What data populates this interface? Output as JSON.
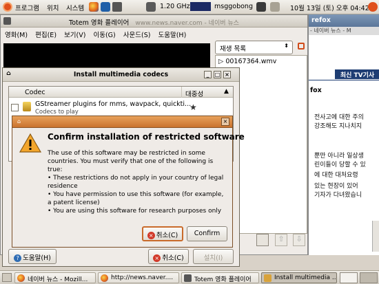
{
  "top_panel": {
    "menus": [
      "프로그램",
      "위치",
      "시스템"
    ],
    "cpu": "1.20 GHz",
    "user": "msggobong",
    "clock": "10월 13일 (토) 오후 04:42"
  },
  "browser_bg": {
    "title_fragment": "refox",
    "url_fragment": "- 네이버 뉴스 - M",
    "tab_label": "최신 TV기사",
    "lines": [
      "전사고에 대한 주의",
      "강조해도 지나치지",
      "뿐만 아니라 일상생",
      "린이들이 당할 수 있",
      "에 대한 대처요령",
      "있는 현장이 있어",
      "기자가 다녀왔습니"
    ]
  },
  "totem": {
    "title": "Totem 영화 플레이어",
    "menu": [
      "영화(M)",
      "편집(E)",
      "보기(V)",
      "이동(G)",
      "사운드(S)",
      "도움말(H)"
    ],
    "playlist_combo": "재생 목록",
    "playlist_item": "00167364.wmv"
  },
  "codecs_dialog": {
    "title": "Install multimedia codecs",
    "col_codec": "Codec",
    "col_popularity": "대중성",
    "row_title": "GStreamer plugins for mms, wavpack, quickti...",
    "row_subtitle": "Codecs to play",
    "help_button": "도움말(H)",
    "cancel_button": "취소(C)",
    "install_button": "설치(I)"
  },
  "confirm_dialog": {
    "heading": "Confirm installation of restricted software",
    "body": "The use of this software may be restricted in some countries. You must verify that one of the following is true:",
    "bullets": [
      "• These restrictions do not apply in your country of legal residence",
      "• You have permission to use this software (for  example, a patent license)",
      "• You are using this software for research purposes only"
    ],
    "cancel_button": "취소(C)",
    "confirm_button": "Confirm"
  },
  "taskbar": {
    "tasks": [
      "네이버 뉴스 - Mozill...",
      "http://news.naver....",
      "Totem 영화 플레이어",
      "Install multimedia ..."
    ]
  }
}
